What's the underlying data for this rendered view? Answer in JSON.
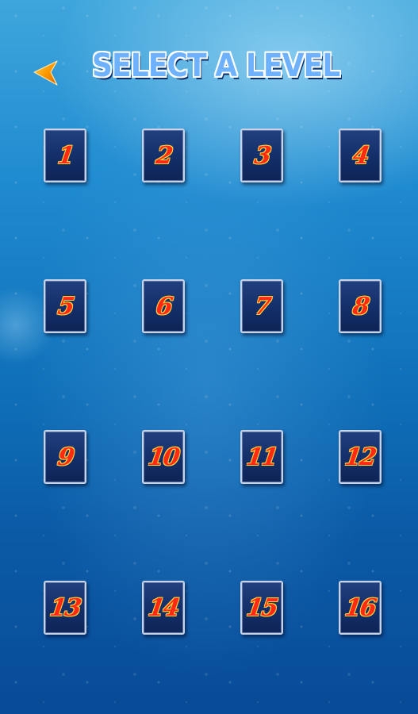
{
  "header": {
    "title": "SELECT A LEVEL",
    "back_icon": "back-arrow-icon"
  },
  "colors": {
    "title_fill": "#6eb2ff",
    "title_outline": "#ffffff",
    "button_bg": "#132e68",
    "button_border": "#c9d3e6",
    "number_fill": "#ff2a12",
    "number_outline": "#ffd23c",
    "back_arrow": "#ff9a00"
  },
  "levels": [
    {
      "label": "1"
    },
    {
      "label": "2"
    },
    {
      "label": "3"
    },
    {
      "label": "4"
    },
    {
      "label": "5"
    },
    {
      "label": "6"
    },
    {
      "label": "7"
    },
    {
      "label": "8"
    },
    {
      "label": "9"
    },
    {
      "label": "10"
    },
    {
      "label": "11"
    },
    {
      "label": "12"
    },
    {
      "label": "13"
    },
    {
      "label": "14"
    },
    {
      "label": "15"
    },
    {
      "label": "16"
    }
  ]
}
